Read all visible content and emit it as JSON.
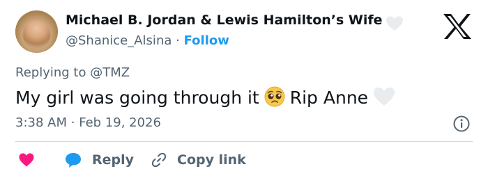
{
  "author": {
    "display_name": "Michael B. Jordan & Lewis Hamilton’s Wife",
    "handle": "@Shanice_Alsina",
    "separator": "·",
    "follow_label": "Follow"
  },
  "reply_context": {
    "prefix": "Replying to",
    "mention": "@TMZ"
  },
  "tweet": {
    "text_part1": "My girl was going through it",
    "text_part2": "Rip Anne",
    "emoji_1": "pleading-face-emoji",
    "emoji_2": "white-heart-emoji"
  },
  "meta": {
    "time": "3:38 AM",
    "separator": "·",
    "date": "Feb 19, 2026"
  },
  "actions": {
    "like_icon": "heart-icon",
    "reply_label": "Reply",
    "copy_label": "Copy link"
  },
  "colors": {
    "text": "#0f1419",
    "muted": "#536471",
    "link": "#1d9bf0",
    "like": "#f91880",
    "divider": "#cfd9de"
  }
}
